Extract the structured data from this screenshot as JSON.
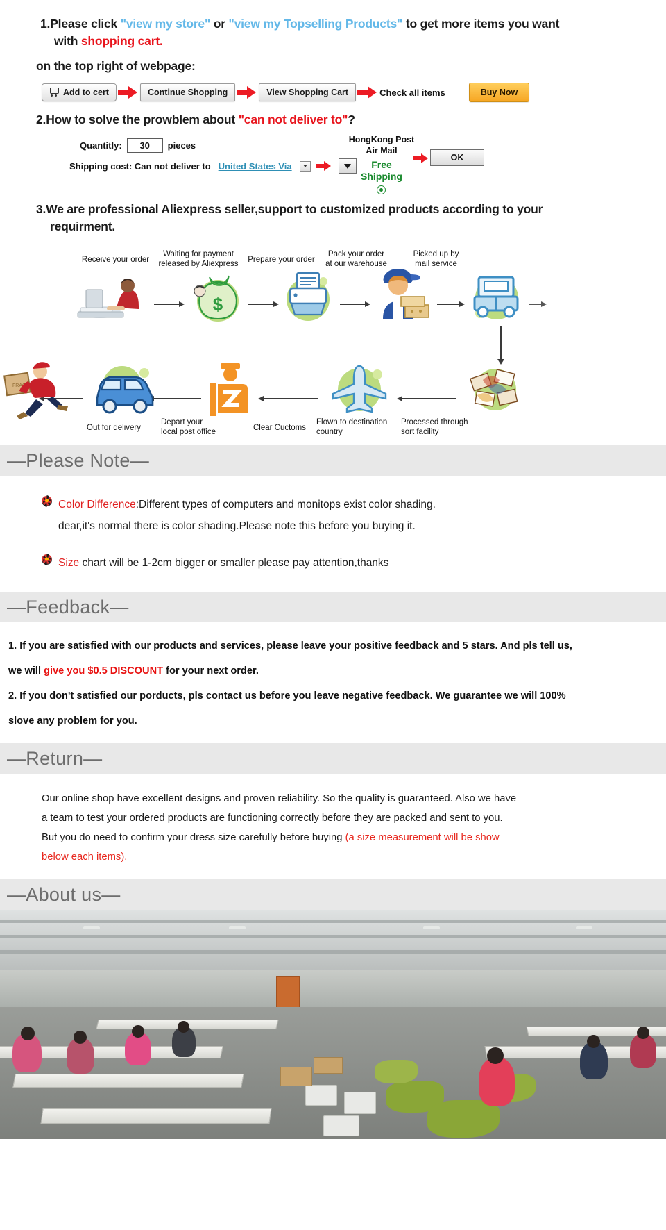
{
  "instructions": {
    "line1_pre": "1.Please click ",
    "line1_link1": "\"view my store\"",
    "line1_mid": " or ",
    "line1_link2": "\"view my Topselling Products\"",
    "line1_post": " to get more items you want",
    "line2_pre": "with ",
    "line2_red": "shopping cart.",
    "line3": "on the top right of webpage:",
    "buttons": [
      {
        "label": "Add to cert",
        "icon": "cart-icon"
      },
      {
        "label": "Continue Shopping"
      },
      {
        "label": "View Shopping Cart"
      }
    ],
    "check_all_items": "Check all items",
    "buy_now": "Buy Now"
  },
  "deliver": {
    "heading_pre": "2.How to solve the prowblem about ",
    "heading_red": "\"can not deliver to\"",
    "heading_post": "?",
    "quantity_label": "Quantitly:",
    "quantity_value": "30",
    "pieces_label": "pieces",
    "shipping_label": "Shipping cost: Can not deliver to",
    "country_value": "United States Via",
    "carrier_line1": "HongKong Post",
    "carrier_line2": "Air Mail",
    "free_line1": "Free",
    "free_line2": "Shipping",
    "ok_label": "OK"
  },
  "custom": {
    "line1": "3.We are professional Aliexpress seller,support to customized products according to your",
    "line2": "requirment."
  },
  "flow": {
    "top_row": [
      {
        "label_line1": "Receive your order",
        "label_line2": "",
        "icon": "person-at-computer-icon"
      },
      {
        "label_line1": "Waiting for payment",
        "label_line2": "released by Aliexpress",
        "icon": "money-bag-icon"
      },
      {
        "label_line1": "Prepare your order",
        "label_line2": "",
        "icon": "printer-icon"
      },
      {
        "label_line1": "Pack your order",
        "label_line2": "at our warehouse",
        "icon": "packer-worker-icon"
      },
      {
        "label_line1": "Picked up by",
        "label_line2": "mail service",
        "icon": "delivery-truck-icon"
      }
    ],
    "bottom_row": [
      {
        "label_line1": "Out for delivery",
        "label_line2": "",
        "icon": "running-courier-icon"
      },
      {
        "label_line1": "Depart your",
        "label_line2": "local post office",
        "icon": "blue-van-icon"
      },
      {
        "label_line1": "Clear Cuctoms",
        "label_line2": "",
        "icon": "customs-officer-icon"
      },
      {
        "label_line1": "Flown to destination",
        "label_line2": "country",
        "icon": "airplane-icon"
      },
      {
        "label_line1": "Processed through",
        "label_line2": "sort facility",
        "icon": "mail-sorting-icon"
      }
    ]
  },
  "sections": {
    "please_note": "—Please Note—",
    "feedback": "—Feedback—",
    "return": "—Return—",
    "about_us": "—About us—"
  },
  "please_note": {
    "item1_red": "Color Difference",
    "item1_rest": ":Different types of computers and monitops exist color shading.",
    "item1_line2": "dear,it's normal there is color shading.Please note this before you buying it.",
    "item2_red": "Size",
    "item2_rest": " chart will be 1-2cm bigger or smaller please pay attention,thanks"
  },
  "feedback": {
    "l1": "1. If you are satisfied with our products and services, please leave your positive feedback and 5 stars. And pls tell us,",
    "l2_pre": "we will ",
    "l2_red": "give you $0.5  DISCOUNT",
    "l2_post": " for your next order.",
    "l3": "2. If you don't satisfied our porducts, pls contact us before you leave negative feedback. We guarantee we will 100%",
    "l4": "slove any problem for you."
  },
  "return": {
    "l1": "Our online shop have excellent designs and proven reliability. So the quality is guaranteed. Also we have",
    "l2": "a team to test your ordered products are functioning correctly before they are packed and sent to you.",
    "l3_pre": "But you do need to confirm your dress size carefully before buying ",
    "l3_red": "(a size measurement will be show",
    "l4_red": "below each items)."
  },
  "about_us": {
    "photo_alt": "garment-factory-sewing-floor-photo"
  },
  "colors": {
    "link_blue": "#63b8e8",
    "accent_red": "#e8141c",
    "banner_bg": "#e8e8e8",
    "banner_text": "#6d6d6d",
    "buy_now_orange": "#f6a623",
    "free_shipping_green": "#1a8a2e",
    "country_link": "#2e8fb5"
  }
}
